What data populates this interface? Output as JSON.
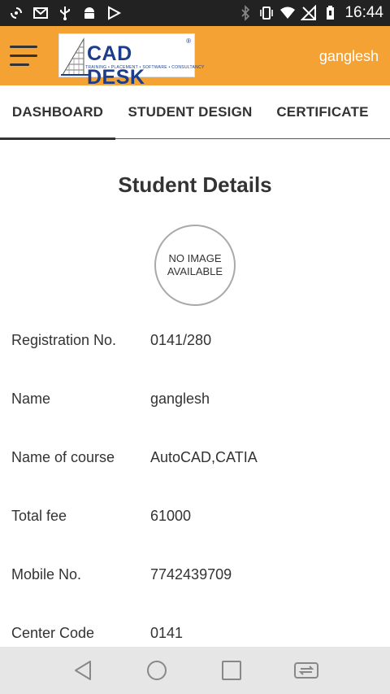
{
  "status_bar": {
    "time": "16:44",
    "left_icons": [
      "sync-icon",
      "gmail-icon",
      "usb-icon",
      "android-icon",
      "play-store-icon"
    ],
    "right_icons": [
      "bluetooth-icon",
      "vibrate-icon",
      "wifi-icon",
      "no-signal-icon",
      "battery-icon"
    ]
  },
  "app_bar": {
    "menu_icon": "hamburger-menu-icon",
    "logo": {
      "title": "CAD DESK",
      "registered": "®",
      "tagline": "TRAINING • PLACEMENT • SOFTWARE • CONSULTANCY"
    },
    "username": "ganglesh",
    "color": "#f5a234"
  },
  "tabs": [
    {
      "label": "DASHBOARD",
      "active": true
    },
    {
      "label": "STUDENT DESIGN",
      "active": false
    },
    {
      "label": "CERTIFICATE",
      "active": false
    }
  ],
  "main": {
    "heading": "Student Details",
    "avatar_placeholder": {
      "line1": "NO IMAGE",
      "line2": "AVAILABLE"
    },
    "fields": [
      {
        "label": "Registration No.",
        "value": "0141/280"
      },
      {
        "label": "Name",
        "value": "ganglesh"
      },
      {
        "label": "Name of course",
        "value": "AutoCAD,CATIA"
      },
      {
        "label": "Total fee",
        "value": "61000"
      },
      {
        "label": "Mobile No.",
        "value": "7742439709"
      },
      {
        "label": "Center Code",
        "value": "0141"
      }
    ]
  },
  "nav_bar": {
    "buttons": [
      "back-icon",
      "home-icon",
      "recents-icon",
      "switch-apps-icon"
    ]
  }
}
